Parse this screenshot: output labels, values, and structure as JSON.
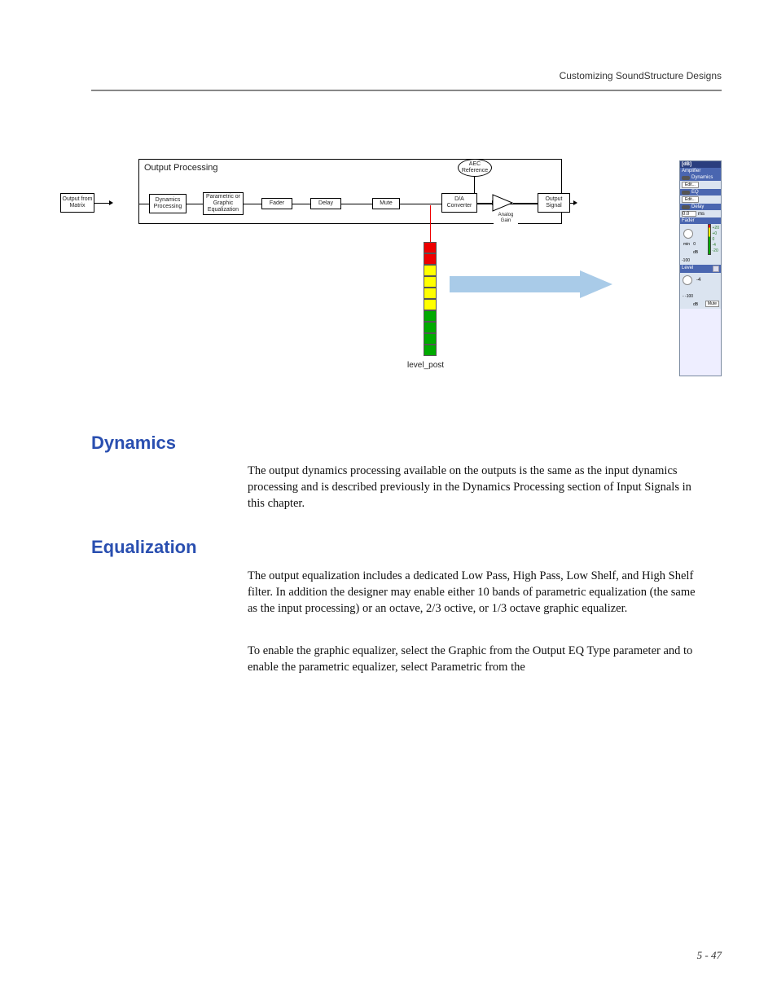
{
  "header": {
    "running_head": "Customizing SoundStructure Designs"
  },
  "diagram": {
    "box_title": "Output Processing",
    "nodes": {
      "in": "Output from\nMatrix",
      "dyn": "Dynamics\nProcessing",
      "eq": "Parametric\nor Graphic\nEqualization",
      "fader": "Fader",
      "delay": "Delay",
      "mute": "Mute",
      "aec": "AEC\nReference",
      "dac": "D/A\nConverter",
      "gain": "Analog\nGain",
      "out": "Output\nSignal"
    },
    "meter_label": "level_post"
  },
  "panel": {
    "title": "[dB]",
    "amp_head": "Amplifier",
    "dyn_head": "Dynamics",
    "eq_head": "EQ",
    "delay_head": "Delay",
    "fader_head": "Fader",
    "level_head": "Level",
    "edit_btn": "Edit...",
    "delay_val": "0.0",
    "delay_unit": "ms",
    "db_unit": "dB",
    "mute_btn": "Mute",
    "scale_top": "+20",
    "scale_0p": "+0",
    "scale_0": "0",
    "scale_n4": "-4",
    "scale_n20": "-20",
    "scale_n100": "-100",
    "level_val": "-4",
    "level_min": "- -100"
  },
  "headings": {
    "dynamics": "Dynamics",
    "equalization": "Equalization"
  },
  "paragraphs": {
    "dynamics_body": "The output dynamics processing available on the outputs is the same as the input dynamics processing and is described previously in the Dynamics Processing section of Input Signals in this chapter.",
    "eq_body1": "The output equalization includes a dedicated Low Pass, High Pass, Low Shelf, and High Shelf filter. In addition the designer may enable either 10 bands of parametric equalization (the same as the input processing) or an octave, 2/3 octive, or 1/3 octave graphic equalizer.",
    "eq_body2": "To enable the graphic equalizer, select the Graphic from the Output EQ Type parameter and to enable the parametric equalizer, select Parametric from the"
  },
  "page_number": "5 - 47"
}
